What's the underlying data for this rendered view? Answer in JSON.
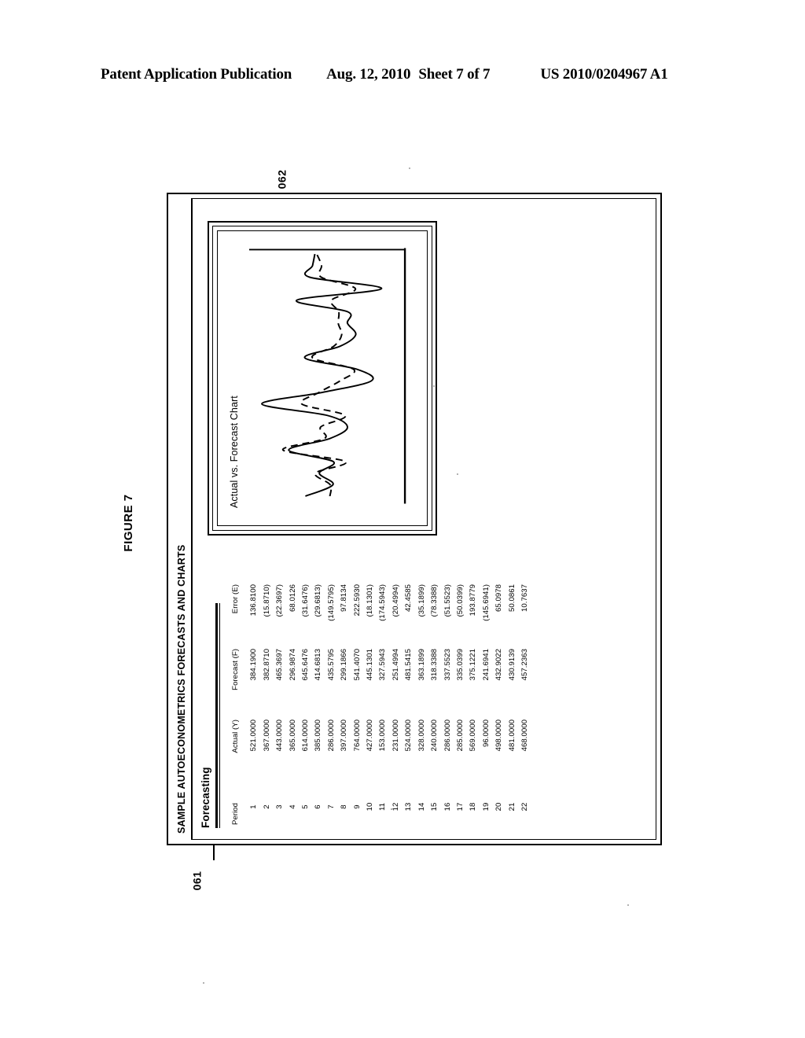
{
  "page_header": {
    "publication": "Patent Application Publication",
    "date": "Aug. 12, 2010",
    "sheet": "Sheet 7 of 7",
    "patent_number": "US 2010/0204967 A1"
  },
  "figure": {
    "label": "FIGURE 7"
  },
  "reference_numerals": {
    "window": "061",
    "chart": "062"
  },
  "window": {
    "title": "SAMPLE AUTOECONOMETRICS FORECASTS AND CHARTS",
    "tab": "Forecasting"
  },
  "table": {
    "headers": {
      "period": "Period",
      "actual": "Actual (Y)",
      "forecast": "Forecast (F)",
      "error": "Error (E)"
    },
    "rows": [
      {
        "period": "1",
        "actual": "521.0000",
        "forecast": "384.1900",
        "error": "136.8100"
      },
      {
        "period": "2",
        "actual": "367.0000",
        "forecast": "382.8710",
        "error": "(15.8710)"
      },
      {
        "period": "3",
        "actual": "443.0000",
        "forecast": "465.3697",
        "error": "(22.3697)"
      },
      {
        "period": "4",
        "actual": "365.0000",
        "forecast": "296.9874",
        "error": "68.0126"
      },
      {
        "period": "5",
        "actual": "614.0000",
        "forecast": "645.6476",
        "error": "(31.6476)"
      },
      {
        "period": "6",
        "actual": "385.0000",
        "forecast": "414.6813",
        "error": "(29.6813)"
      },
      {
        "period": "7",
        "actual": "286.0000",
        "forecast": "435.5795",
        "error": "(149.5795)"
      },
      {
        "period": "8",
        "actual": "397.0000",
        "forecast": "299.1866",
        "error": "97.8134"
      },
      {
        "period": "9",
        "actual": "764.0000",
        "forecast": "541.4070",
        "error": "222.5930"
      },
      {
        "period": "10",
        "actual": "427.0000",
        "forecast": "445.1301",
        "error": "(18.1301)"
      },
      {
        "period": "11",
        "actual": "153.0000",
        "forecast": "327.5943",
        "error": "(174.5943)"
      },
      {
        "period": "12",
        "actual": "231.0000",
        "forecast": "251.4994",
        "error": "(20.4994)"
      },
      {
        "period": "13",
        "actual": "524.0000",
        "forecast": "481.5415",
        "error": "42.4585"
      },
      {
        "period": "14",
        "actual": "328.0000",
        "forecast": "363.1899",
        "error": "(35.1899)"
      },
      {
        "period": "15",
        "actual": "240.0000",
        "forecast": "318.3388",
        "error": "(78.3388)"
      },
      {
        "period": "16",
        "actual": "286.0000",
        "forecast": "337.5523",
        "error": "(51.5523)"
      },
      {
        "period": "17",
        "actual": "285.0000",
        "forecast": "335.0399",
        "error": "(50.0399)"
      },
      {
        "period": "18",
        "actual": "569.0000",
        "forecast": "375.1221",
        "error": "193.8779"
      },
      {
        "period": "19",
        "actual": "96.0000",
        "forecast": "241.6941",
        "error": "(145.6941)"
      },
      {
        "period": "20",
        "actual": "498.0000",
        "forecast": "432.9022",
        "error": "65.0978"
      },
      {
        "period": "21",
        "actual": "481.0000",
        "forecast": "430.9139",
        "error": "50.0861"
      },
      {
        "period": "22",
        "actual": "468.0000",
        "forecast": "457.2363",
        "error": "10.7637"
      }
    ]
  },
  "chart": {
    "title": "Actual vs. Forecast Chart"
  },
  "chart_data": {
    "type": "line",
    "title": "Actual vs. Forecast Chart",
    "xlabel": "",
    "ylabel": "",
    "grid": false,
    "legend_position": "none",
    "x": [
      1,
      2,
      3,
      4,
      5,
      6,
      7,
      8,
      9,
      10,
      11,
      12,
      13,
      14,
      15,
      16,
      17,
      18,
      19,
      20,
      21,
      22
    ],
    "xlim": [
      1,
      22
    ],
    "ylim": [
      0,
      800
    ],
    "series": [
      {
        "name": "Actual (Y)",
        "style": "solid",
        "values": [
          521,
          367,
          443,
          365,
          614,
          385,
          286,
          397,
          764,
          427,
          153,
          231,
          524,
          328,
          240,
          286,
          285,
          569,
          96,
          498,
          481,
          468
        ]
      },
      {
        "name": "Forecast (F)",
        "style": "dashed",
        "values": [
          384.19,
          382.871,
          465.3697,
          296.9874,
          645.6476,
          414.6813,
          435.5795,
          299.1866,
          541.407,
          445.1301,
          327.5943,
          251.4994,
          481.5415,
          363.1899,
          318.3388,
          337.5523,
          335.0399,
          375.1221,
          241.6941,
          432.9022,
          430.9139,
          457.2363
        ]
      }
    ]
  },
  "colors": {
    "ink": "#000000",
    "paper": "#ffffff"
  }
}
